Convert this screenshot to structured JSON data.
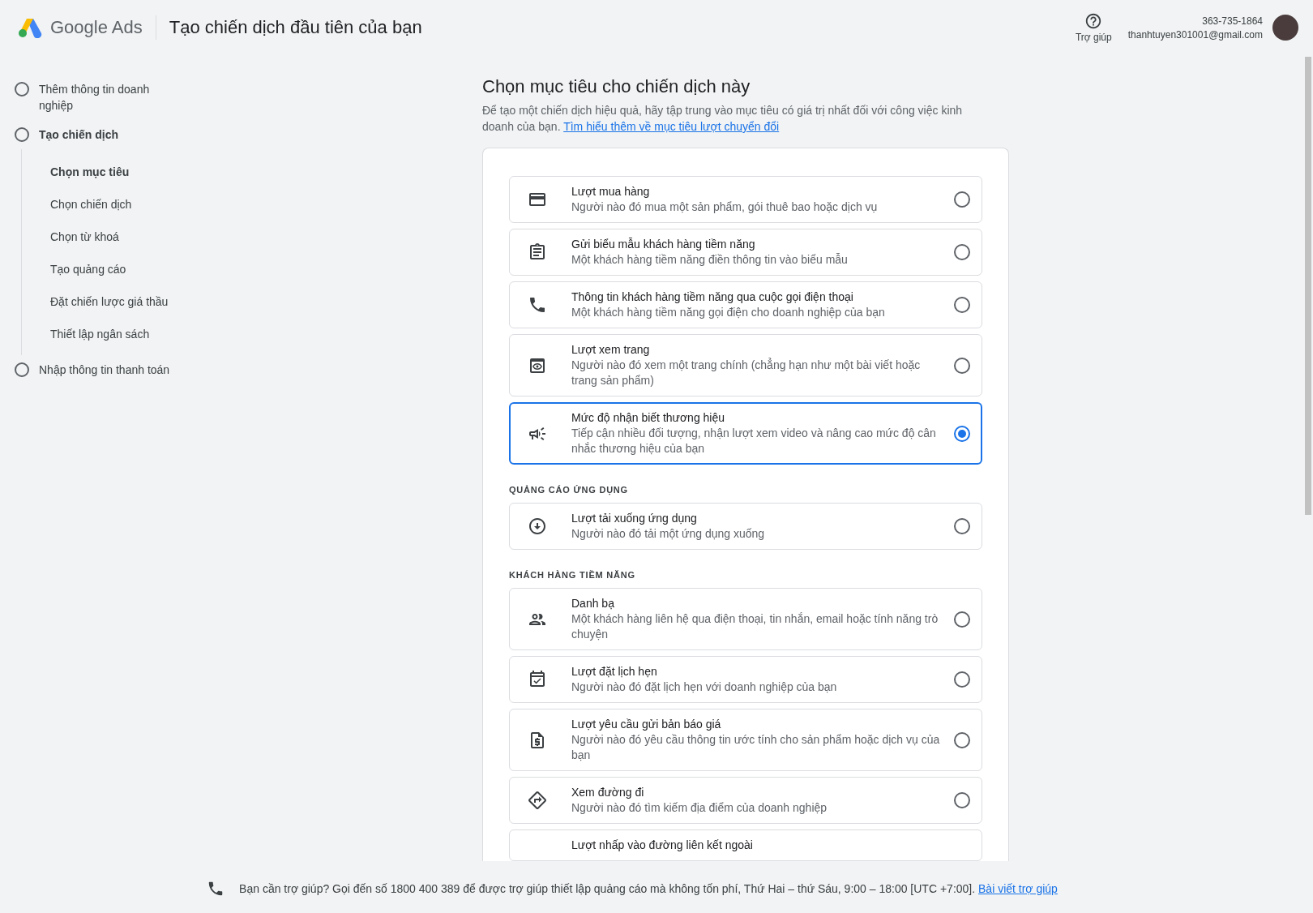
{
  "header": {
    "product": "Google Ads",
    "title": "Tạo chiến dịch đầu tiên của bạn",
    "help_label": "Trợ giúp",
    "phone": "363-735-1864",
    "email": "thanhtuyen301001@gmail.com"
  },
  "steps": [
    {
      "label": "Thêm thông tin doanh nghiệp",
      "selected": false
    },
    {
      "label": "Tạo chiến dịch",
      "selected": true,
      "children": [
        {
          "label": "Chọn mục tiêu",
          "selected": true
        },
        {
          "label": "Chọn chiến dịch",
          "selected": false
        },
        {
          "label": "Chọn từ khoá",
          "selected": false
        },
        {
          "label": "Tạo quảng cáo",
          "selected": false
        },
        {
          "label": "Đặt chiến lược giá thầu",
          "selected": false
        },
        {
          "label": "Thiết lập ngân sách",
          "selected": false
        }
      ]
    },
    {
      "label": "Nhập thông tin thanh toán",
      "selected": false
    }
  ],
  "page": {
    "heading": "Chọn mục tiêu cho chiến dịch này",
    "intro": "Để tạo một chiến dịch hiệu quả, hãy tập trung vào mục tiêu có giá trị nhất đối với công việc kinh doanh của bạn.",
    "intro_link": "Tìm hiểu thêm về mục tiêu lượt chuyển đổi"
  },
  "groups": [
    {
      "options": [
        {
          "title": "Lượt mua hàng",
          "description": "Người nào đó mua một sản phẩm, gói thuê bao hoặc dịch vụ",
          "selected": false
        },
        {
          "title": "Gửi biểu mẫu khách hàng tiềm năng",
          "description": "Một khách hàng tiềm năng điền thông tin vào biểu mẫu",
          "selected": false
        },
        {
          "title": "Thông tin khách hàng tiềm năng qua cuộc gọi điện thoại",
          "description": "Một khách hàng tiềm năng gọi điện cho doanh nghiệp của bạn",
          "selected": false
        },
        {
          "title": "Lượt xem trang",
          "description": "Người nào đó xem một trang chính (chẳng hạn như một bài viết hoặc trang sản phẩm)",
          "selected": false
        },
        {
          "title": "Mức độ nhận biết thương hiệu",
          "description": "Tiếp cận nhiều đối tượng, nhận lượt xem video và nâng cao mức độ cân nhắc thương hiệu của bạn",
          "selected": true
        }
      ]
    },
    {
      "title": "QUẢNG CÁO ỨNG DỤNG",
      "options": [
        {
          "title": "Lượt tải xuống ứng dụng",
          "description": "Người nào đó tải một ứng dụng xuống",
          "selected": false
        }
      ]
    },
    {
      "title": "KHÁCH HÀNG TIỀM NĂNG",
      "options": [
        {
          "title": "Danh bạ",
          "description": "Một khách hàng liên hệ qua điện thoại, tin nhắn, email hoặc tính năng trò chuyện",
          "selected": false
        },
        {
          "title": "Lượt đặt lịch hẹn",
          "description": "Người nào đó đặt lịch hẹn với doanh nghiệp của bạn",
          "selected": false
        },
        {
          "title": "Lượt yêu cầu gửi bản báo giá",
          "description": "Người nào đó yêu cầu thông tin ước tính cho sản phẩm hoặc dịch vụ của bạn",
          "selected": false
        },
        {
          "title": "Xem đường đi",
          "description": "Người nào đó tìm kiếm địa điểm của doanh nghiệp",
          "selected": false
        },
        {
          "title": "Lượt nhấp vào đường liên kết ngoài"
        }
      ]
    }
  ],
  "footer": {
    "text": "Bạn cần trợ giúp? Gọi đến số 1800 400 389 để được trợ giúp thiết lập quảng cáo mà không tốn phí, Thứ Hai – thứ Sáu, 9:00 – 18:00 [UTC +7:00].",
    "link": "Bài viết trợ giúp"
  }
}
